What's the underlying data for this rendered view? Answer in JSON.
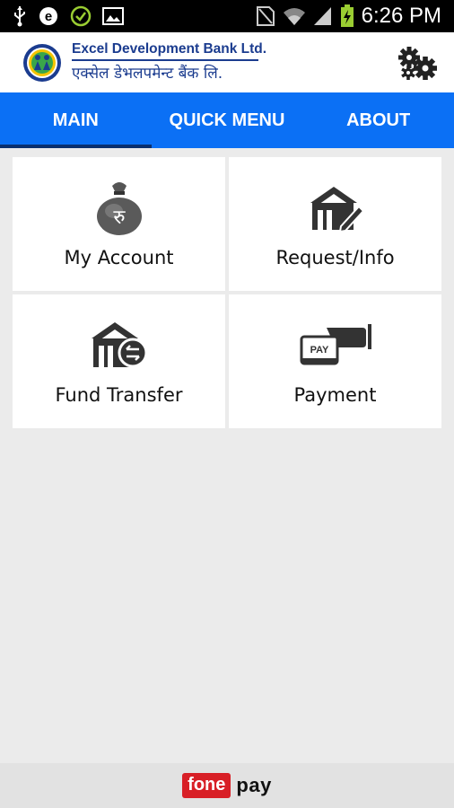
{
  "status_bar": {
    "time": "6:26 PM",
    "left_icons": [
      "usb-icon",
      "e-app-icon",
      "check-circle-icon",
      "image-icon"
    ],
    "right_icons": [
      "sim-off-icon",
      "wifi-icon",
      "signal-icon",
      "battery-charging-icon"
    ]
  },
  "header": {
    "bank_name_en": "Excel Development Bank Ltd.",
    "bank_name_np": "एक्सेल डेभलपमेन्ट बैंक लि.",
    "brand_color": "#1b3c8f"
  },
  "tabs": [
    {
      "label": "MAIN",
      "active": true
    },
    {
      "label": "QUICK MENU",
      "active": false
    },
    {
      "label": "ABOUT",
      "active": false
    }
  ],
  "tab_bar_color": "#0b70f5",
  "cards": [
    {
      "label": "My Account",
      "icon": "money-bag-icon"
    },
    {
      "label": "Request/Info",
      "icon": "bank-edit-icon"
    },
    {
      "label": "Fund Transfer",
      "icon": "bank-transfer-icon"
    },
    {
      "label": "Payment",
      "icon": "pay-card-icon"
    }
  ],
  "footer": {
    "brand_part1": "fone",
    "brand_part2": "pay",
    "brand_color": "#d81f26"
  }
}
